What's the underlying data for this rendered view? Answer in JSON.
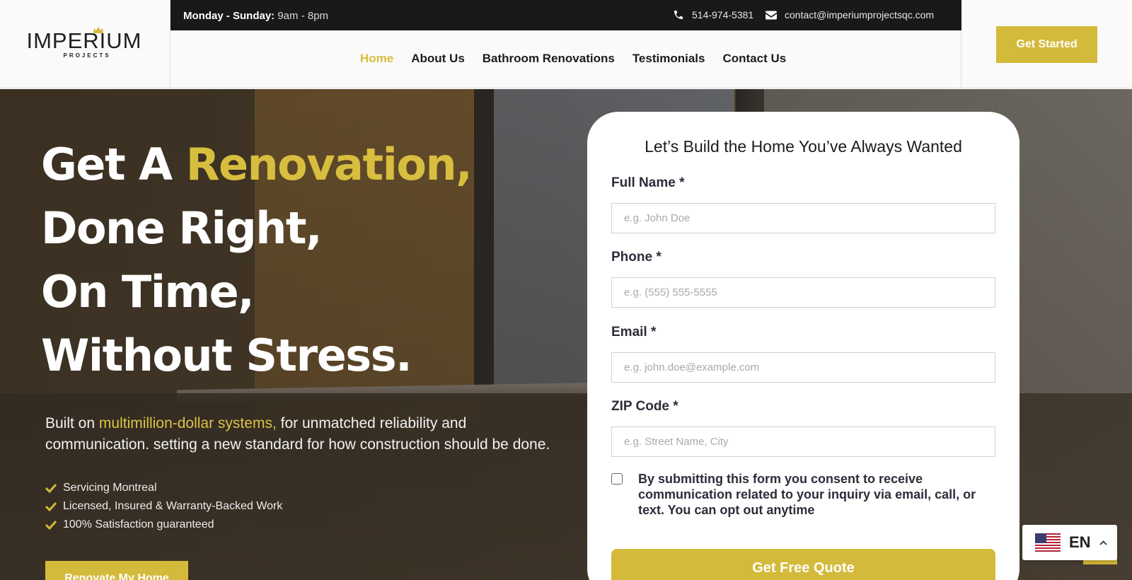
{
  "brand": {
    "logo_text": "IMPERIUM",
    "logo_sub": "PROJECTS"
  },
  "topbar": {
    "hours_label": "Monday - Sunday:",
    "hours_value": "9am - 8pm",
    "phone": "514-974-5381",
    "email": "contact@imperiumprojectsqc.com"
  },
  "nav": {
    "items": [
      {
        "label": "Home",
        "active": true
      },
      {
        "label": "About Us",
        "active": false
      },
      {
        "label": "Bathroom Renovations",
        "active": false
      },
      {
        "label": "Testimonials",
        "active": false
      },
      {
        "label": "Contact Us",
        "active": false
      }
    ],
    "cta_label": "Get Started"
  },
  "hero": {
    "line1_plain": "Get A ",
    "line1_highlight": "Renovation,",
    "line2": "Done Right,",
    "line3": "On Time,",
    "line4": "Without Stress.",
    "sub_before": "Built on ",
    "sub_highlight": "multimillion-dollar systems,",
    "sub_after": " for unmatched reliability and communication. setting a new standard for how construction should be done.",
    "checks": [
      "Servicing Montreal",
      "Licensed, Insured & Warranty-Backed Work",
      "100% Satisfaction guaranteed"
    ],
    "button_label": "Renovate My Home"
  },
  "form": {
    "title": "Let’s Build the Home You’ve Always Wanted",
    "fields": {
      "name_label": "Full Name *",
      "name_placeholder": "e.g. John Doe",
      "phone_label": "Phone *",
      "phone_placeholder": "e.g. (555) 555-5555",
      "email_label": "Email *",
      "email_placeholder": "e.g. john.doe@example.com",
      "zip_label": "ZIP Code *",
      "zip_placeholder": "e.g. Street Name, City"
    },
    "consent_text": "By submitting this form you consent to receive communication related to your inquiry via email, call, or text. You can opt out anytime",
    "submit_label": "Get Free Quote"
  },
  "language": {
    "code": "EN",
    "flag_icon": "us-flag-icon"
  },
  "colors": {
    "accent": "#d4ba3a",
    "topbar_bg": "#191919",
    "header_bg": "#fafafa"
  }
}
